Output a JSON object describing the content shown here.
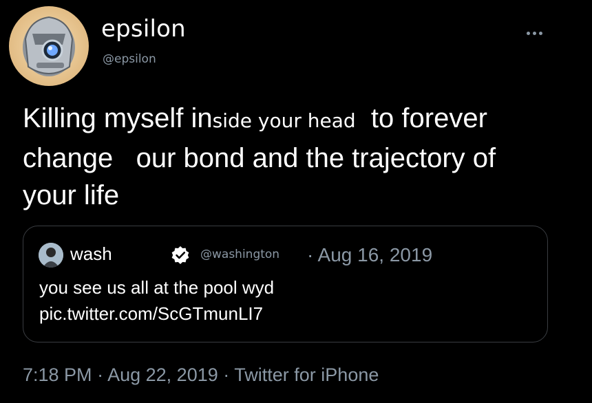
{
  "author": {
    "display_name": "epsilon",
    "handle": "@epsilon",
    "avatar_icon": "armored-helmet-avatar"
  },
  "more_icon": "more-options-icon",
  "tweet": {
    "line1_a": "Killing myself in",
    "line1_edit": "side your head",
    "line1_b": "to forever",
    "line2_a": "change",
    "line2_b": "our bond and the trajectory of",
    "line3": "your life"
  },
  "quoted": {
    "name": "wash",
    "handle": "@washington",
    "date": "· Aug 16, 2019",
    "text_line1": "you see us all at the pool wyd",
    "text_line2": "pic.twitter.com/ScGTmunLI7",
    "verified_icon": "verified-badge-icon"
  },
  "footer": {
    "time": "7:18 PM",
    "sep": "·",
    "date": "Aug 22, 2019",
    "source": "Twitter for iPhone"
  },
  "colors": {
    "background": "#000000",
    "text": "#ffffff",
    "secondary": "#8b98a5",
    "border": "#3a3d42"
  }
}
